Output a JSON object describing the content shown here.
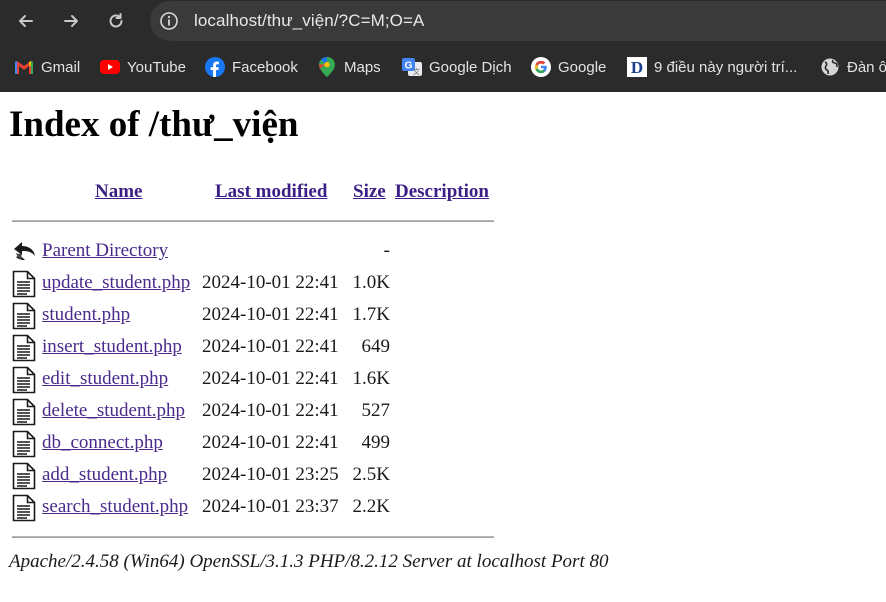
{
  "browser": {
    "url": "localhost/thư_viện/?C=M;O=A",
    "bookmarks": [
      {
        "label": "Gmail",
        "icon": "gmail-icon"
      },
      {
        "label": "YouTube",
        "icon": "youtube-icon"
      },
      {
        "label": "Facebook",
        "icon": "facebook-icon"
      },
      {
        "label": "Maps",
        "icon": "maps-icon"
      },
      {
        "label": "Google Dịch",
        "icon": "google-translate-icon"
      },
      {
        "label": "Google",
        "icon": "google-icon"
      },
      {
        "label": "9 điều này người trí...",
        "icon": "d-site-icon"
      },
      {
        "label": "Đàn ô",
        "icon": "globe-icon"
      }
    ]
  },
  "page": {
    "title": "Index of /thư_viện",
    "columns": {
      "name": "Name",
      "last_modified": "Last modified",
      "size": "Size",
      "description": "Description"
    },
    "parent": {
      "name": "Parent Directory",
      "size": "-"
    },
    "files": [
      {
        "name": "update_student.php",
        "modified": "2024-10-01 22:41",
        "size": "1.0K"
      },
      {
        "name": "student.php",
        "modified": "2024-10-01 22:41",
        "size": "1.7K"
      },
      {
        "name": "insert_student.php",
        "modified": "2024-10-01 22:41",
        "size": "649"
      },
      {
        "name": "edit_student.php",
        "modified": "2024-10-01 22:41",
        "size": "1.6K"
      },
      {
        "name": "delete_student.php",
        "modified": "2024-10-01 22:41",
        "size": "527"
      },
      {
        "name": "db_connect.php",
        "modified": "2024-10-01 22:41",
        "size": "499"
      },
      {
        "name": "add_student.php",
        "modified": "2024-10-01 23:25",
        "size": "2.5K"
      },
      {
        "name": "search_student.php",
        "modified": "2024-10-01 23:37",
        "size": "2.2K"
      }
    ],
    "footer": "Apache/2.4.58 (Win64) OpenSSL/3.1.3 PHP/8.2.12 Server at localhost Port 80"
  }
}
